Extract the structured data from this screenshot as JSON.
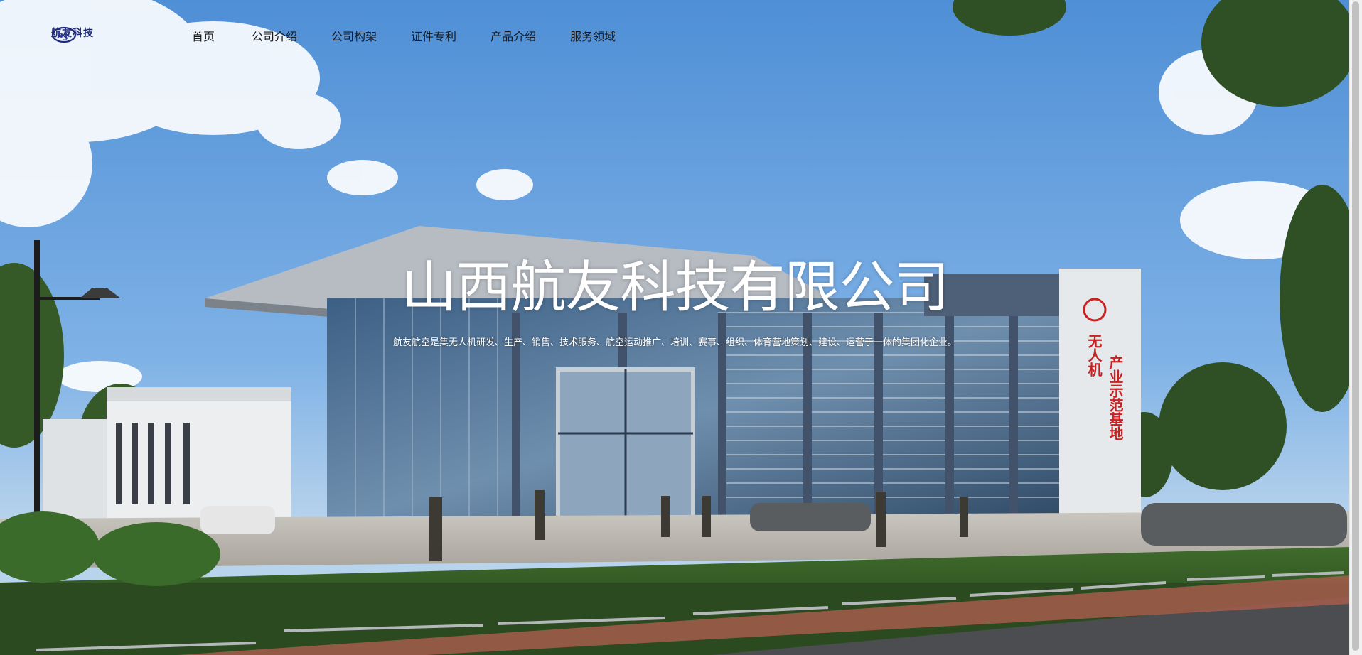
{
  "brand": {
    "name": "航友科技",
    "logo_icon": "hy-logo-icon",
    "color": "#1d2a7a"
  },
  "nav": {
    "items": [
      {
        "label": "首页"
      },
      {
        "label": "公司介绍"
      },
      {
        "label": "公司构架"
      },
      {
        "label": "证件专利"
      },
      {
        "label": "产品介绍"
      },
      {
        "label": "服务领域"
      }
    ]
  },
  "hero": {
    "title": "山西航友科技有限公司",
    "subtitle": "航友航空是集无人机研发、生产、销售、技术服务、航空运动推广、培训、赛事、组织、体育营地策划、建设、运营于一体的集团化企业。",
    "sign_line_1": "无人机",
    "sign_line_2": "产业示范基地",
    "sign_color": "#cc1f1f"
  }
}
